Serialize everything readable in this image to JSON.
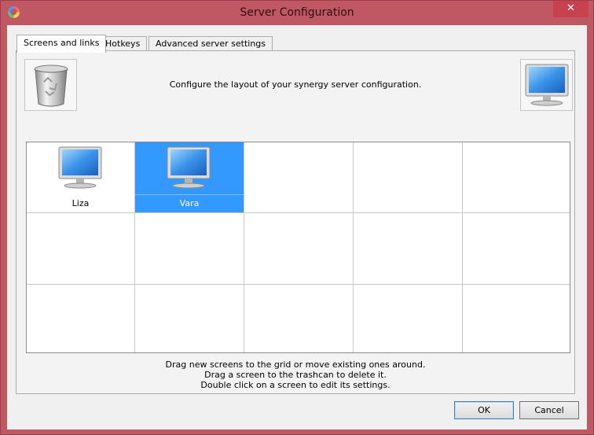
{
  "window": {
    "title": "Server Configuration",
    "close_glyph": "✕"
  },
  "tabs": [
    {
      "label": "Screens and links",
      "active": true
    },
    {
      "label": "Hotkeys",
      "active": false
    },
    {
      "label": "Advanced server settings",
      "active": false
    }
  ],
  "panel": {
    "header_text": "Configure the layout of your synergy server configuration.",
    "trash_icon": "trashcan-icon",
    "new_screen_icon": "monitor-icon"
  },
  "grid": {
    "columns": 5,
    "rows": 3,
    "screens": [
      {
        "name": "Liza",
        "col": 0,
        "row": 0,
        "selected": false
      },
      {
        "name": "Vara",
        "col": 1,
        "row": 0,
        "selected": true
      }
    ]
  },
  "hints": [
    "Drag new screens to the grid or move existing ones around.",
    "Drag a screen to the trashcan to delete it.",
    "Double click on a screen to edit its settings."
  ],
  "buttons": {
    "ok": "OK",
    "cancel": "Cancel"
  },
  "colors": {
    "selection": "#3399ff",
    "titlebar": "#c05864",
    "close": "#c7424f"
  }
}
